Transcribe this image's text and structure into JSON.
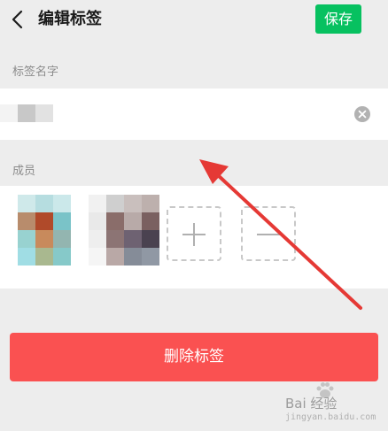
{
  "header": {
    "title": "编辑标签",
    "save_label": "保存"
  },
  "tag_name": {
    "section_label": "标签名字",
    "value": "",
    "placeholder": "",
    "value_pixelated": true
  },
  "members": {
    "section_label": "成员",
    "avatars_pixelated": true,
    "add_icon": "plus-icon",
    "remove_icon": "minus-icon"
  },
  "actions": {
    "delete_label": "删除标签"
  },
  "watermark": {
    "text": "Bai 经验",
    "url": "jingyan.baidu.com"
  },
  "colors": {
    "accent_green": "#07c160",
    "danger_red": "#fa5151",
    "page_background": "#ededed",
    "annotation_arrow": "#e53935"
  }
}
